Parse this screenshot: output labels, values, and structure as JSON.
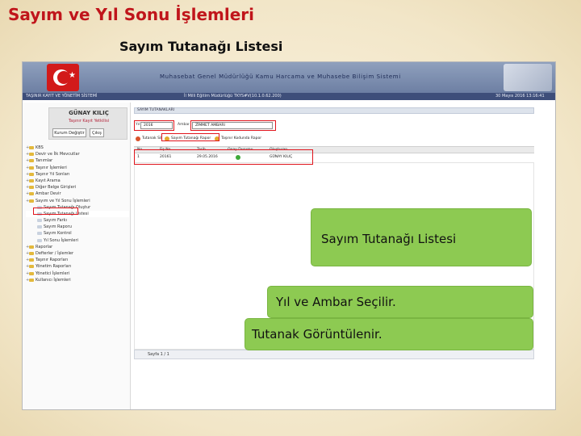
{
  "slide": {
    "title": "Sayım ve Yıl Sonu İşlemleri",
    "subtitle": "Sayım Tutanağı Listesi"
  },
  "app": {
    "title": "Muhasebat Genel Müdürlüğü Kamu Harcama ve Muhasebe Bilişim Sistemi",
    "info_left": "TAŞINIR KAYIT VE YÖNETİM SİSTEMİ",
    "info_center": "İl Milli Eğitim Müdürlüğü TKYS#V(10.1.0.62.200)",
    "info_right": "30 Mayıs 2016 13:16:41"
  },
  "user": {
    "name": "GÜNAY KILIÇ",
    "role": "Taşınır Kayıt Yetkilisi",
    "change_unit_label": "Kurum Değiştir",
    "logout_label": "Çıkış"
  },
  "menu": [
    {
      "label": "KBS",
      "level": 1
    },
    {
      "label": "Devir ve İlk Mevcutlar",
      "level": 1
    },
    {
      "label": "Tanımlar",
      "level": 1
    },
    {
      "label": "Taşınır İşlemleri",
      "level": 1
    },
    {
      "label": "Taşınır Yıl Sonları",
      "level": 1
    },
    {
      "label": "Kayıt Arama",
      "level": 1
    },
    {
      "label": "Diğer Belge Girişleri",
      "level": 1
    },
    {
      "label": "Ambar Devir",
      "level": 1
    },
    {
      "label": "Sayım ve Yıl Sonu İşlemleri",
      "level": 1
    },
    {
      "label": "Sayım Tutanağı Oluştur",
      "level": 2
    },
    {
      "label": "Sayım Tutanağı Listesi",
      "level": 2,
      "active": true
    },
    {
      "label": "Sayım Farkı",
      "level": 2
    },
    {
      "label": "Sayım Raporu",
      "level": 2
    },
    {
      "label": "Sayım Kontrol",
      "level": 2
    },
    {
      "label": "Yıl Sonu İşlemleri",
      "level": 2
    },
    {
      "label": "Raporlar",
      "level": 1
    },
    {
      "label": "Defterler / İşlemler",
      "level": 1
    },
    {
      "label": "Taşınır Raporları",
      "level": 1
    },
    {
      "label": "Yönetim Raporları",
      "level": 1
    },
    {
      "label": "Yönetici İşlemleri",
      "level": 1
    },
    {
      "label": "Kullanıcı İşlemleri",
      "level": 1
    }
  ],
  "panel": {
    "header": "SAYIM TUTANAKLARI",
    "year_label": "Yıl",
    "year_value": "2016",
    "warehouse_label": "Ambar",
    "warehouse_value": "ZİMMET AMBARI",
    "toolbar": {
      "delete_label": "Tutanak Sil",
      "report_label": "Sayım Tutanağı Rapor",
      "barcode_label": "Taşınır Kodunda Rapor"
    },
    "columns": [
      "No",
      "Fiş No",
      "Tarih",
      "Onay Durumu",
      "Oluşturan"
    ],
    "rows": [
      {
        "no": "1",
        "fis_no": "20161",
        "tarih": "29.05.2016",
        "oluşturan": "GÜNAY KILIÇ"
      }
    ],
    "pager": "Sayfa 1 / 1"
  },
  "callouts": {
    "list_title": "Sayım Tutanağı Listesi",
    "select_hint": "Yıl ve Ambar Seçilir.",
    "view_hint": "Tutanak Görüntülenir."
  },
  "colors": {
    "title_red": "#c0151b",
    "callout_green": "#8dca52",
    "highlight_red": "#e0141c"
  }
}
